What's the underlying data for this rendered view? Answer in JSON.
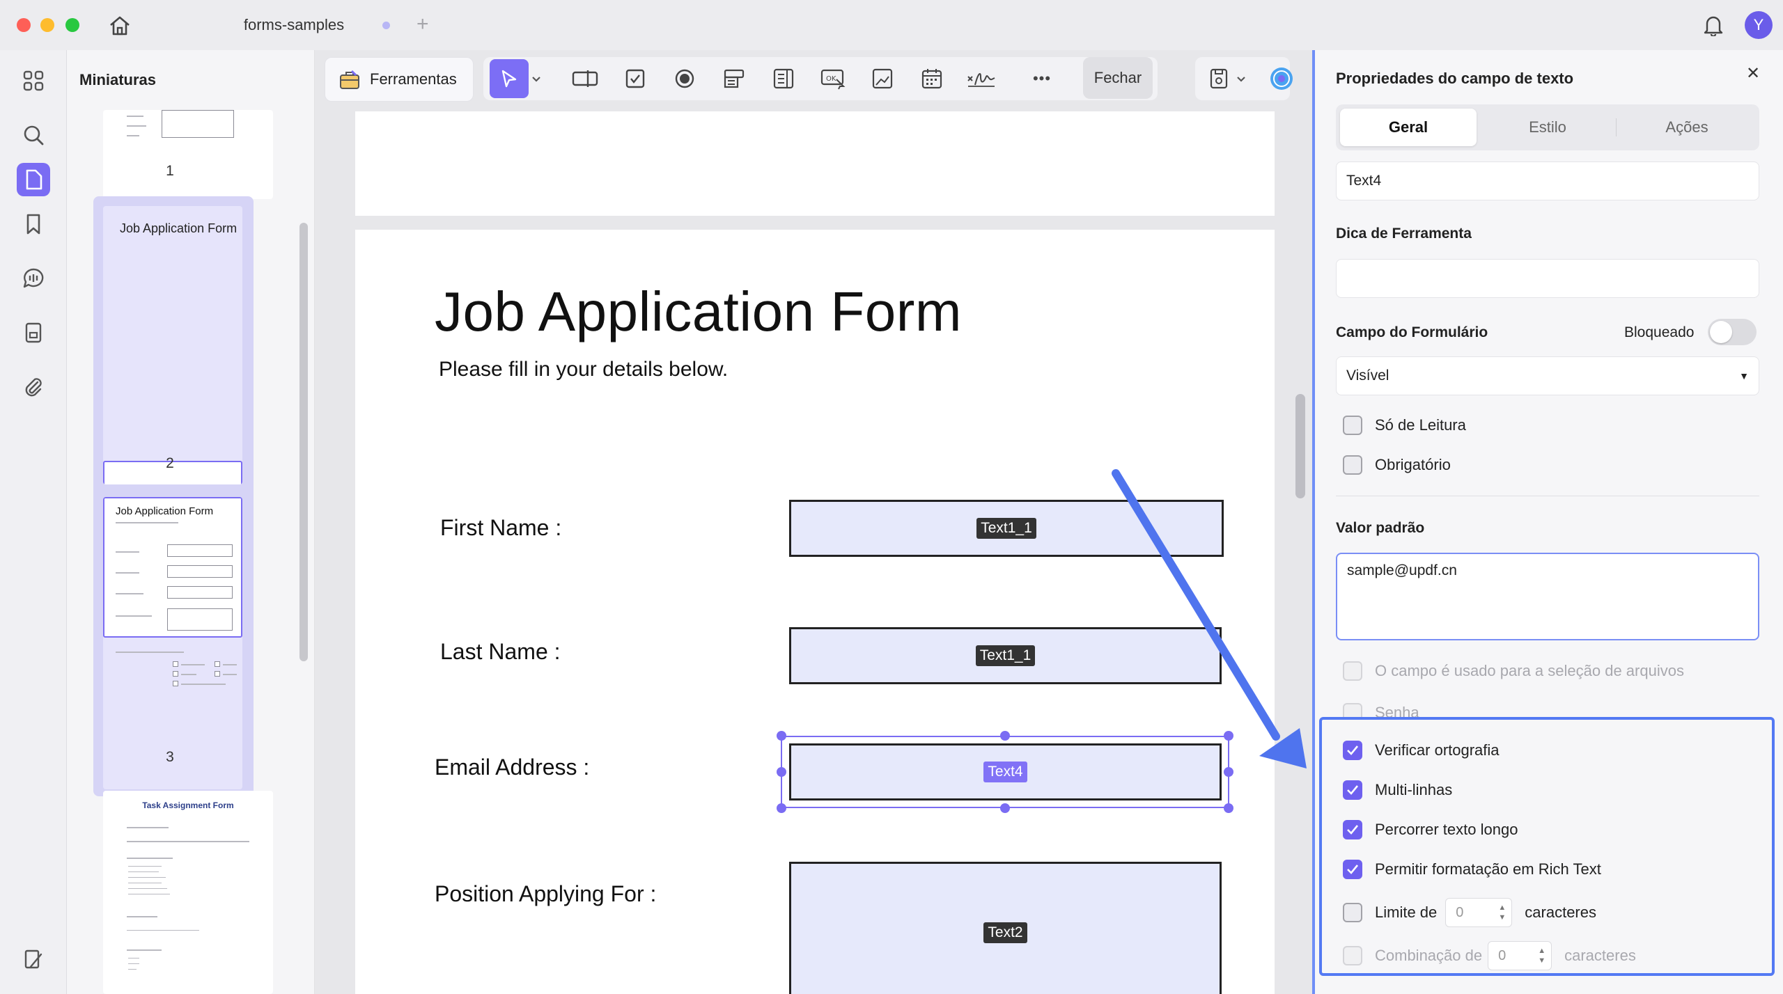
{
  "window": {
    "tab_title": "forms-samples",
    "tab_add": "+",
    "avatar_initial": "Y"
  },
  "thumbnails": {
    "title": "Miniaturas",
    "pages": [
      {
        "number": "1"
      },
      {
        "number": "2",
        "title": "Job Application Form"
      },
      {
        "number": "3",
        "title": "Job Application Form"
      },
      {
        "number": "",
        "title": "Task Assignment Form"
      }
    ]
  },
  "toolbar": {
    "tools_label": "Ferramentas",
    "close_label": "Fechar",
    "more_label": "•••"
  },
  "document": {
    "title": "Job Application Form",
    "subtitle": "Please fill in your details below.",
    "fields": [
      {
        "label": "First Name :",
        "tag": "Text1_1"
      },
      {
        "label": "Last Name :",
        "tag": "Text1_1"
      },
      {
        "label": "Email Address :",
        "tag": "Text4"
      },
      {
        "label": "Position Applying For :",
        "tag": "Text2"
      }
    ]
  },
  "panel": {
    "title": "Propriedades do campo de texto",
    "tabs": [
      "Geral",
      "Estilo",
      "Ações"
    ],
    "active_tab": "Geral",
    "field_name": "Text4",
    "tooltip_label": "Dica de Ferramenta",
    "tooltip_value": "",
    "form_field_label": "Campo do Formulário",
    "locked_label": "Bloqueado",
    "locked": false,
    "visibility": "Visível",
    "read_only_label": "Só de Leitura",
    "required_label": "Obrigatório",
    "default_value_label": "Valor padrão",
    "default_value": "sample@updf.cn",
    "file_select_label": "O campo é usado para a seleção de arquivos",
    "password_label": "Senha",
    "spellcheck_label": "Verificar ortografia",
    "multiline_label": "Multi-linhas",
    "scroll_long_text_label": "Percorrer texto longo",
    "rich_text_label": "Permitir formatação em Rich Text",
    "char_limit_prefix": "Limite de",
    "char_limit_value": "0",
    "char_limit_suffix": "caracteres",
    "comb_prefix": "Combinação de",
    "comb_value": "0",
    "comb_suffix": "caracteres"
  },
  "colors": {
    "accent": "#7a6cf3",
    "highlight_border": "#5379f3",
    "field_fill": "#e6e9fb"
  }
}
